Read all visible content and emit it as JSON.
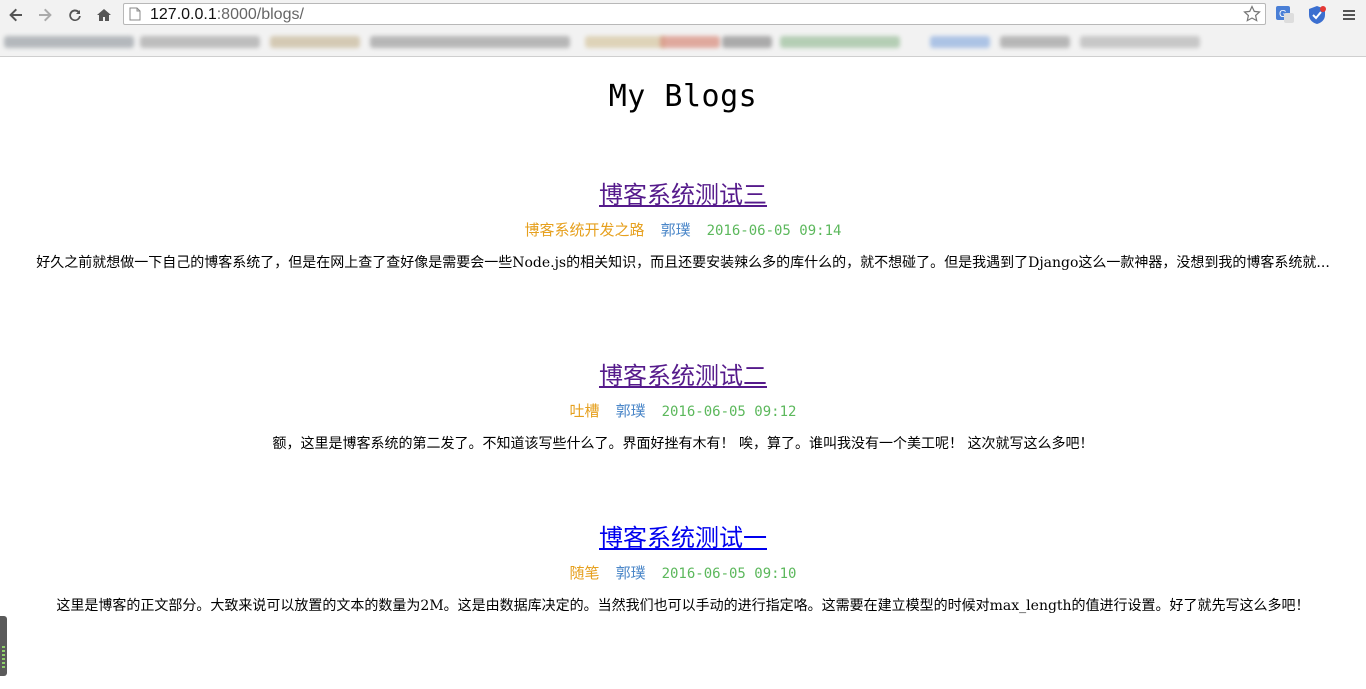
{
  "browser": {
    "url_host": "127.0.0.1",
    "url_rest": ":8000/blogs/"
  },
  "page": {
    "title": "My Blogs"
  },
  "posts": [
    {
      "title": "博客系统测试三",
      "category": "博客系统开发之路",
      "author": "郭璞",
      "date": "2016-06-05 09:14",
      "excerpt": "好久之前就想做一下自己的博客系统了，但是在网上查了查好像是需要会一些Node.js的相关知识，而且还要安装辣么多的库什么的，就不想碰了。但是我遇到了Django这么一款神器，没想到我的博客系统就..."
    },
    {
      "title": "博客系统测试二",
      "category": "吐槽",
      "author": "郭璞",
      "date": "2016-06-05 09:12",
      "excerpt": "额，这里是博客系统的第二发了。不知道该写些什么了。界面好挫有木有！ 唉，算了。谁叫我没有一个美工呢！ 这次就写这么多吧！"
    },
    {
      "title": "博客系统测试一",
      "category": "随笔",
      "author": "郭璞",
      "date": "2016-06-05 09:10",
      "excerpt": "这里是博客的正文部分。大致来说可以放置的文本的数量为2M。这是由数据库决定的。当然我们也可以手动的进行指定咯。这需要在建立模型的时候对max_length的值进行设置。好了就先写这么多吧！"
    }
  ],
  "colors": {
    "visited_link": "#551a8b",
    "link": "#0000ee",
    "category": "#e6a01e",
    "author": "#4a86c8",
    "date": "#5cb85c"
  }
}
